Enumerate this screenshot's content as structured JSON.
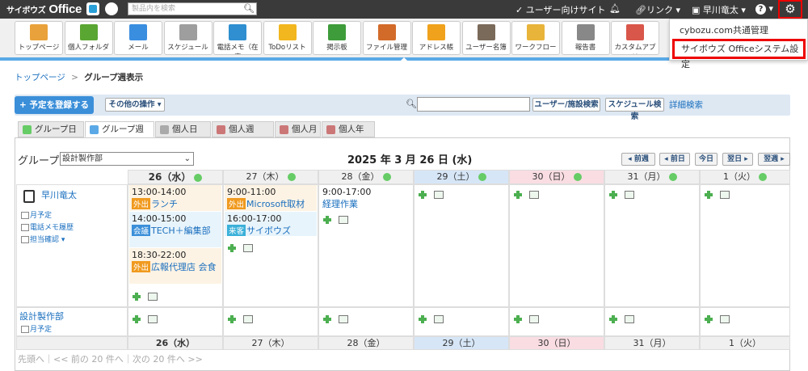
{
  "topbar": {
    "brand_main": "サイボウズ",
    "brand_office": "Office",
    "search_placeholder": "製品内を検索",
    "user_site": "ユーザー向けサイト",
    "link_menu": "リンク",
    "user_name": "早川竜太",
    "help": "?"
  },
  "apps": [
    {
      "label": "トップページ",
      "color": "#e9a23b"
    },
    {
      "label": "個人フォルダ",
      "color": "#5aa632"
    },
    {
      "label": "メール",
      "color": "#3a8ee0"
    },
    {
      "label": "スケジュール",
      "color": "#9e9e9e"
    },
    {
      "label": "電話メモ（在席",
      "color": "#2f8fd0"
    },
    {
      "label": "ToDoリスト",
      "color": "#f2b61e"
    },
    {
      "label": "掲示板",
      "color": "#3e9c3a"
    },
    {
      "label": "ファイル管理",
      "color": "#d26b2a"
    },
    {
      "label": "アドレス帳",
      "color": "#f0a21c"
    },
    {
      "label": "ユーザー名簿",
      "color": "#7a6a5a"
    },
    {
      "label": "ワークフロー",
      "color": "#e8b43a"
    },
    {
      "label": "報告書",
      "color": "#888888"
    },
    {
      "label": "カスタムアプリ",
      "color": "#d9564a"
    }
  ],
  "dropdown": {
    "item1": "cybozu.com共通管理",
    "item2": "サイボウズ Officeシステム設定"
  },
  "breadcrumb": {
    "home": "トップページ",
    "sep": ">",
    "current": "グループ週表示"
  },
  "toolbar": {
    "register": "予定を登録する",
    "other_ops": "その他の操作",
    "user_search": "ユーザー/施設検索",
    "schedule_search": "スケジュール検索",
    "detail_search": "詳細検索"
  },
  "tabs": [
    "グループ日",
    "グループ週",
    "個人日",
    "個人週",
    "個人月",
    "個人年"
  ],
  "calendar": {
    "group_label": "グループ",
    "group_value": "設計製作部",
    "date_title": "2025 年 3 月 26 日 (水)",
    "nav": [
      "前週",
      "前日",
      "今日",
      "翌日",
      "翌週"
    ],
    "days": [
      {
        "label": "26（水）",
        "type": "today"
      },
      {
        "label": "27（木）",
        "type": "weekday"
      },
      {
        "label": "28（金）",
        "type": "weekday"
      },
      {
        "label": "29（土）",
        "type": "sat"
      },
      {
        "label": "30（日）",
        "type": "sun"
      },
      {
        "label": "31（月）",
        "type": "weekday"
      },
      {
        "label": "1（火）",
        "type": "weekday"
      }
    ],
    "user": {
      "name": "早川竜太",
      "links": [
        "月予定",
        "電話メモ履歴",
        "担当確認"
      ]
    },
    "group_row": {
      "name": "設計製作部",
      "link": "月予定"
    },
    "events": {
      "wed": [
        {
          "time": "13:00-14:00",
          "tag": "外出",
          "title": "ランチ"
        },
        {
          "time": "14:00-15:00",
          "tag": "会議",
          "title": "TECH＋編集部"
        },
        {
          "time": "18:30-22:00",
          "tag": "外出",
          "title": "広報代理店 会食"
        }
      ],
      "thu": [
        {
          "time": "9:00-11:00",
          "tag": "外出",
          "title": "Microsoft取材"
        },
        {
          "time": "16:00-17:00",
          "tag": "来客",
          "title": "サイボウズ"
        }
      ],
      "fri": [
        {
          "time": "9:00-17:00",
          "title": "経理作業"
        }
      ]
    },
    "tag_colors": {
      "外出": "#f09a1f",
      "会議": "#3b8fd9",
      "来客": "#3bb0d9"
    },
    "paging": "先頭へ｜<< 前の 20 件へ｜次の 20 件へ >>"
  }
}
